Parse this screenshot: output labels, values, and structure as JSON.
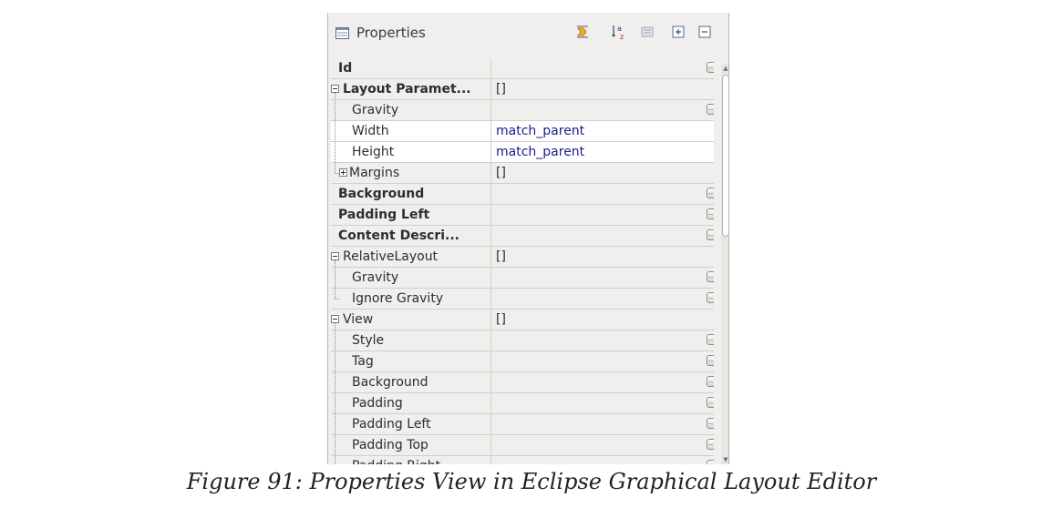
{
  "panel": {
    "title": "Properties",
    "toolbar": [
      {
        "name": "show-advanced-properties-icon"
      },
      {
        "name": "sort-alphabetically-icon"
      },
      {
        "name": "restore-default-icon"
      },
      {
        "name": "expand-all-icon"
      },
      {
        "name": "collapse-all-icon"
      }
    ]
  },
  "rows": [
    {
      "name": "Id",
      "bold": true,
      "indent": 0,
      "value": "",
      "ellipsis": true
    },
    {
      "name": "Layout Paramet...",
      "bold": true,
      "indent": 0,
      "expander": "minus",
      "value": "[]",
      "ellipsis": false
    },
    {
      "name": "Gravity",
      "bold": false,
      "indent": 1,
      "value": "",
      "ellipsis": true
    },
    {
      "name": "Width",
      "bold": false,
      "indent": 1,
      "value": "match_parent",
      "white": true,
      "ellipsis": false
    },
    {
      "name": "Height",
      "bold": false,
      "indent": 1,
      "value": "match_parent",
      "white": true,
      "ellipsis": false
    },
    {
      "name": "Margins",
      "bold": false,
      "indent": 1,
      "expander": "plus",
      "value": "[]",
      "ellipsis": false
    },
    {
      "name": "Background",
      "bold": true,
      "indent": 0,
      "value": "",
      "ellipsis": true
    },
    {
      "name": "Padding Left",
      "bold": true,
      "indent": 0,
      "value": "",
      "ellipsis": true
    },
    {
      "name": "Content Descri...",
      "bold": true,
      "indent": 0,
      "value": "",
      "ellipsis": true
    },
    {
      "name": "RelativeLayout",
      "bold": false,
      "indent": 0,
      "expander": "minus",
      "value": "[]",
      "ellipsis": false
    },
    {
      "name": "Gravity",
      "bold": false,
      "indent": 1,
      "value": "",
      "ellipsis": true
    },
    {
      "name": "Ignore Gravity",
      "bold": false,
      "indent": 1,
      "value": "",
      "ellipsis": true
    },
    {
      "name": "View",
      "bold": false,
      "indent": 0,
      "expander": "minus",
      "value": "[]",
      "ellipsis": false
    },
    {
      "name": "Style",
      "bold": false,
      "indent": 1,
      "value": "",
      "ellipsis": true
    },
    {
      "name": "Tag",
      "bold": false,
      "indent": 1,
      "value": "",
      "ellipsis": true
    },
    {
      "name": "Background",
      "bold": false,
      "indent": 1,
      "value": "",
      "ellipsis": true
    },
    {
      "name": "Padding",
      "bold": false,
      "indent": 1,
      "value": "",
      "ellipsis": true
    },
    {
      "name": "Padding Left",
      "bold": false,
      "indent": 1,
      "value": "",
      "ellipsis": true
    },
    {
      "name": "Padding Top",
      "bold": false,
      "indent": 1,
      "value": "",
      "ellipsis": true
    },
    {
      "name": "Padding Right",
      "bold": false,
      "indent": 1,
      "value": "",
      "ellipsis": true
    }
  ],
  "ellipsis_label": "...",
  "caption": "Figure 91: Properties View in Eclipse Graphical Layout Editor"
}
